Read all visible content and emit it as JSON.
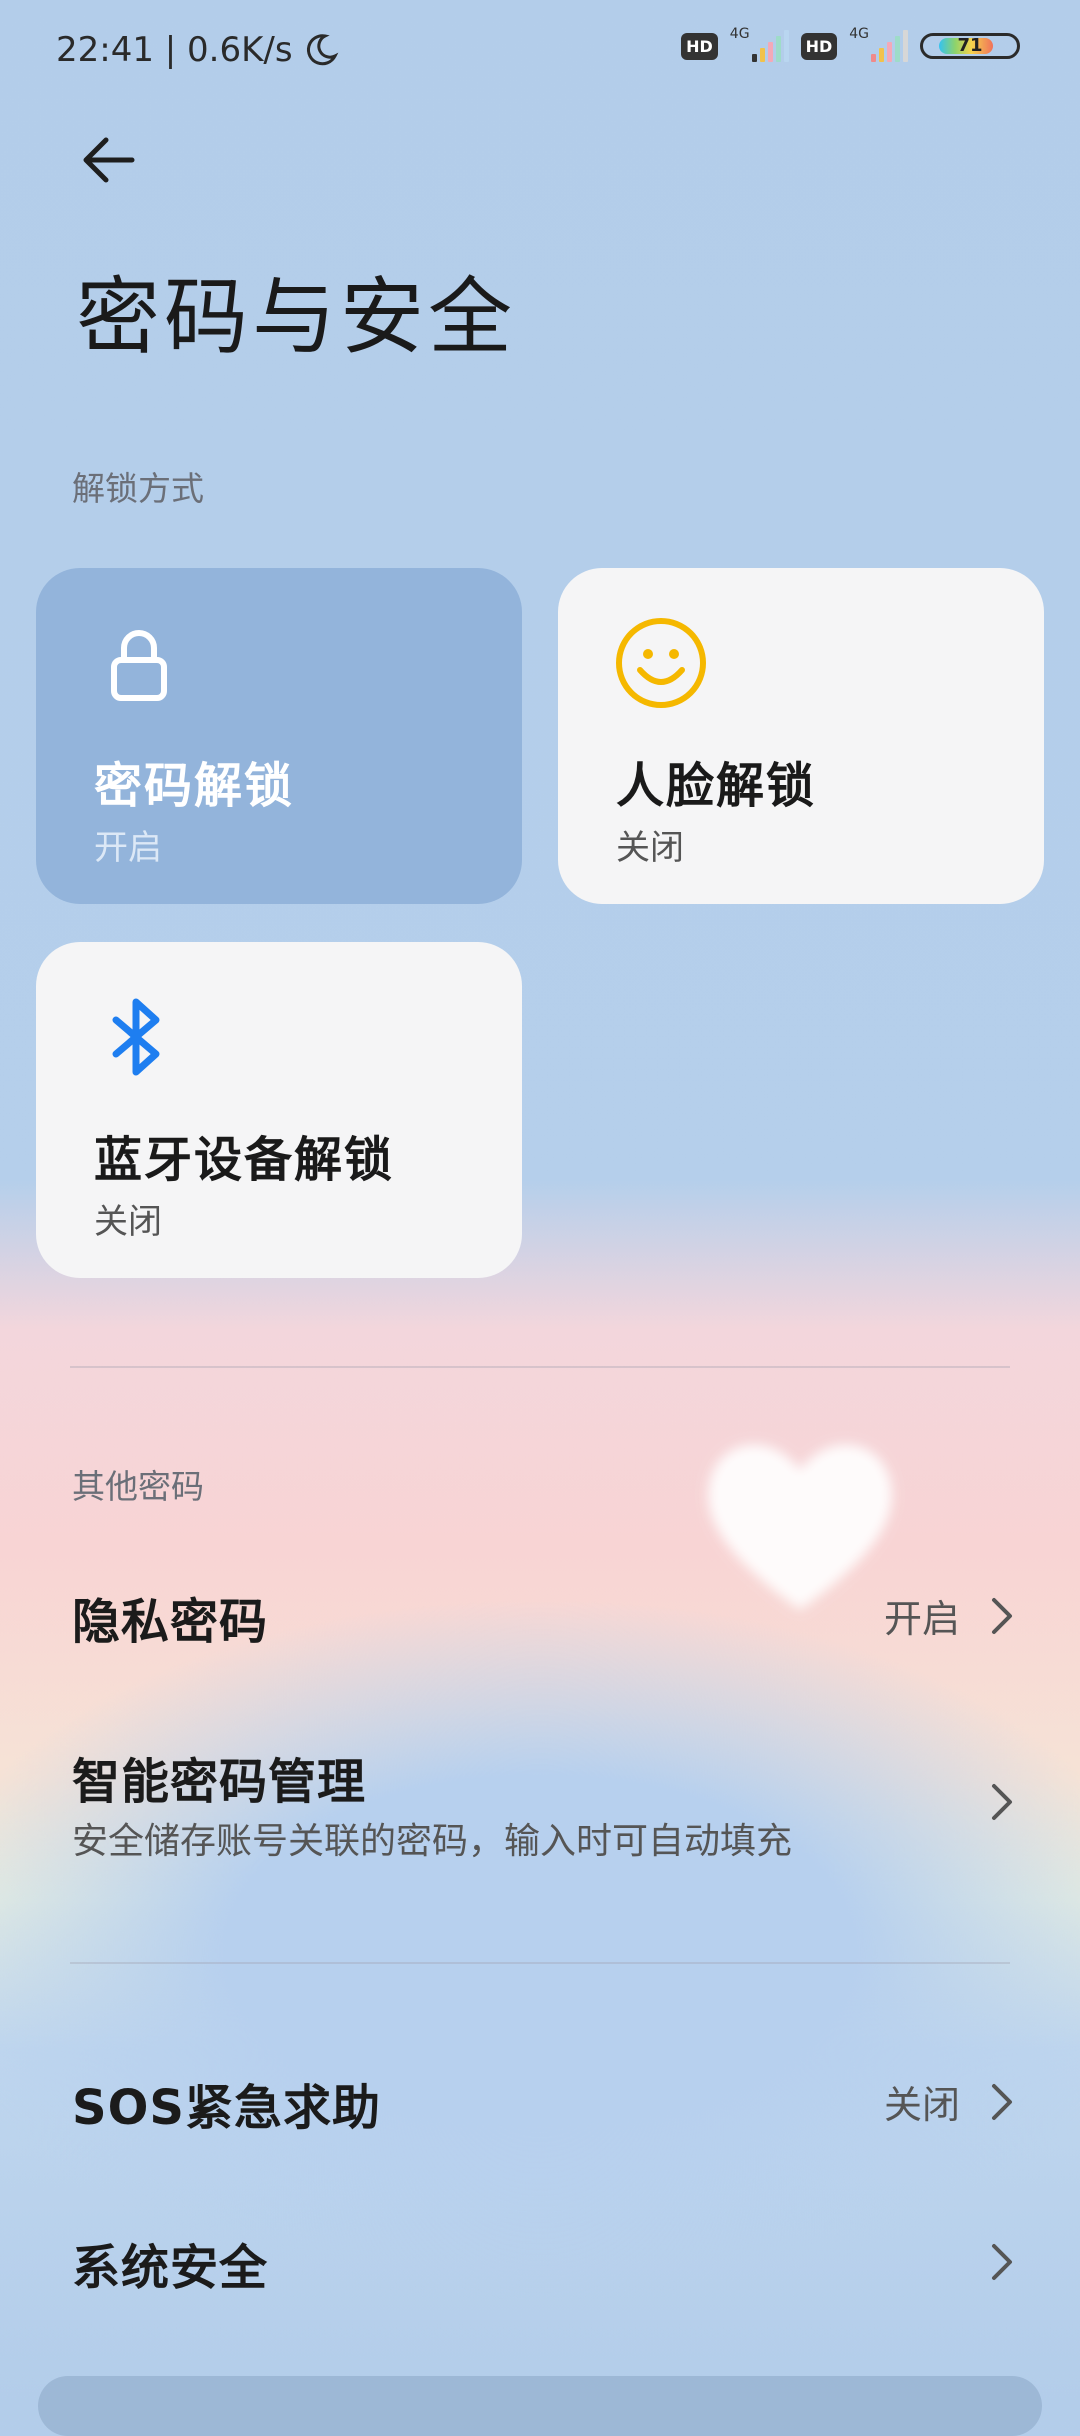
{
  "status_bar": {
    "time_speed": "22:41 | 0.6K/s",
    "sim1_badge": "HD",
    "sim1_network": "4G",
    "sim2_badge": "HD",
    "sim2_network": "4G",
    "battery": "71",
    "battery_level": 0.71
  },
  "header": {
    "title": "密码与安全"
  },
  "unlock_section": {
    "label": "解锁方式",
    "cards": [
      {
        "title": "密码解锁",
        "status": "开启",
        "icon": "lock-icon"
      },
      {
        "title": "人脸解锁",
        "status": "关闭",
        "icon": "smiley-icon"
      },
      {
        "title": "蓝牙设备解锁",
        "status": "关闭",
        "icon": "bluetooth-icon"
      }
    ]
  },
  "other_section": {
    "label": "其他密码",
    "items": [
      {
        "title": "隐私密码",
        "value": "开启"
      },
      {
        "title": "智能密码管理",
        "subtitle": "安全储存账号关联的密码，输入时可自动填充"
      }
    ]
  },
  "misc_section": {
    "items": [
      {
        "title": "SOS紧急求助",
        "value": "关闭"
      },
      {
        "title": "系统安全"
      }
    ]
  },
  "colors": {
    "accent_lock_card": "#93b4db",
    "smiley": "#f5b800",
    "bluetooth": "#1e7ef0"
  }
}
